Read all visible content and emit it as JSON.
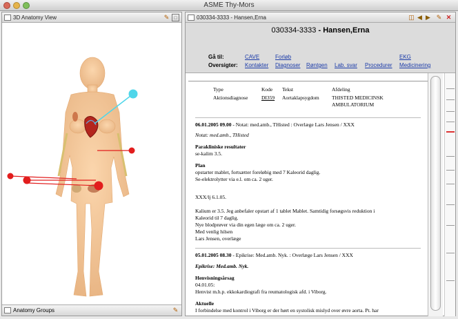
{
  "window": {
    "title": "ASME Thy-Mors"
  },
  "left_pane": {
    "tab": "3D Anatomy View",
    "bottom_tab": "Anatomy Groups"
  },
  "right_pane": {
    "tab": "030334-3333 - Hansen,Erna",
    "patient_id": "030334-3333",
    "patient_name": "Hansen,Erna",
    "goto_label": "Gå til:",
    "overview_label": "Oversigter:",
    "goto_links": [
      "CAVE",
      "Forløb",
      "EKG"
    ],
    "overview_links": [
      "Kontakter",
      "Diagnoser",
      "Røntgen",
      "Lab. svar",
      "Procedurer",
      "Medicinering"
    ]
  },
  "doc": {
    "table_headers": [
      "Type",
      "Kode",
      "Tekst",
      "Afdeling"
    ],
    "table_row": [
      "Aktionsdiagnose",
      "DI359",
      "Aortaklapsygdom",
      "THISTED MEDICINSK AMBULATORIUM"
    ],
    "n1_date": "06.01.2005 09.00",
    "n1_head": " - Notat: med.amb., THisted : Overlæge Lars Jensen / XXX",
    "n1_notat": "Notat: med.amb., THisted",
    "n1_para": "Parakliniske resultater",
    "n1_para_text": "se-kalim 3.5.",
    "n1_plan": "Plan",
    "n1_plan_1": "opstarter mablet, fortsætter foreløbig med 7 Kaleorid daglig.",
    "n1_plan_2": "Se-elektrolytter via e.l. om ca. 2 uger.",
    "n1_sig": "XXX/lj 6.1.05.",
    "n1_body_1": "Kalium er 3.5. Jeg anbefaler opstart af 1 tablet Mablet. Samtidig forsøgsvis reduktion i",
    "n1_body_2": "Kaleorid til 7 daglig.",
    "n1_body_3": "Nye blodprøver via din egen læge om ca. 2 uger.",
    "n1_body_4": "Med venlig hilsen",
    "n1_body_5": "Lars Jensen, overlæge",
    "n2_date": "05.01.2005 08.30",
    "n2_head": " - Epikrise: Med.amb. Nyk. : Overlæge Lars Jensen / XXX",
    "n2_epikrise": "Epikrise: Med.amb. Nyk.",
    "n2_henv": "Henvisningsårsag",
    "n2_henv_1": "04.01.05:",
    "n2_henv_2": "Henvist m.h.p. ekkokardiografi fra reumatologisk afd. i Viborg.",
    "n2_akt": "Aktuelle",
    "n2_akt_1": "I forbindelse med kontrol i Viborg er der hørt en systolisk mislyd over øvre aorta. Pt. har"
  },
  "colors": {
    "marker_red": "#e21d1d",
    "marker_cyan": "#4fd6ea",
    "body": "#f3c79a"
  }
}
